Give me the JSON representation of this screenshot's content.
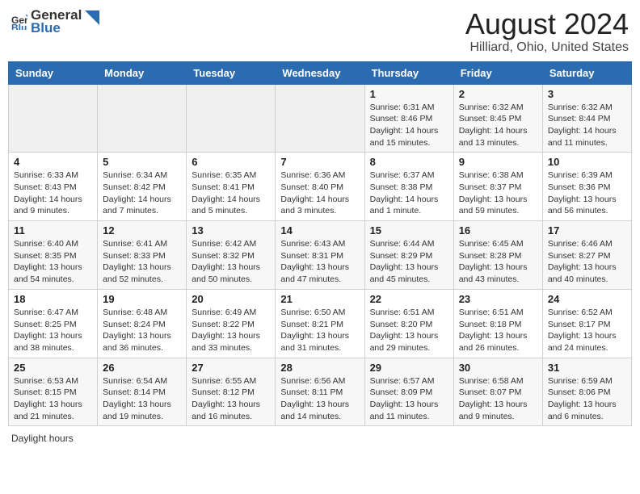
{
  "header": {
    "logo_general": "General",
    "logo_blue": "Blue",
    "month_title": "August 2024",
    "location": "Hilliard, Ohio, United States"
  },
  "days_of_week": [
    "Sunday",
    "Monday",
    "Tuesday",
    "Wednesday",
    "Thursday",
    "Friday",
    "Saturday"
  ],
  "weeks": [
    [
      {
        "day": "",
        "info": ""
      },
      {
        "day": "",
        "info": ""
      },
      {
        "day": "",
        "info": ""
      },
      {
        "day": "",
        "info": ""
      },
      {
        "day": "1",
        "sunrise": "Sunrise: 6:31 AM",
        "sunset": "Sunset: 8:46 PM",
        "daylight": "Daylight: 14 hours and 15 minutes."
      },
      {
        "day": "2",
        "sunrise": "Sunrise: 6:32 AM",
        "sunset": "Sunset: 8:45 PM",
        "daylight": "Daylight: 14 hours and 13 minutes."
      },
      {
        "day": "3",
        "sunrise": "Sunrise: 6:32 AM",
        "sunset": "Sunset: 8:44 PM",
        "daylight": "Daylight: 14 hours and 11 minutes."
      }
    ],
    [
      {
        "day": "4",
        "sunrise": "Sunrise: 6:33 AM",
        "sunset": "Sunset: 8:43 PM",
        "daylight": "Daylight: 14 hours and 9 minutes."
      },
      {
        "day": "5",
        "sunrise": "Sunrise: 6:34 AM",
        "sunset": "Sunset: 8:42 PM",
        "daylight": "Daylight: 14 hours and 7 minutes."
      },
      {
        "day": "6",
        "sunrise": "Sunrise: 6:35 AM",
        "sunset": "Sunset: 8:41 PM",
        "daylight": "Daylight: 14 hours and 5 minutes."
      },
      {
        "day": "7",
        "sunrise": "Sunrise: 6:36 AM",
        "sunset": "Sunset: 8:40 PM",
        "daylight": "Daylight: 14 hours and 3 minutes."
      },
      {
        "day": "8",
        "sunrise": "Sunrise: 6:37 AM",
        "sunset": "Sunset: 8:38 PM",
        "daylight": "Daylight: 14 hours and 1 minute."
      },
      {
        "day": "9",
        "sunrise": "Sunrise: 6:38 AM",
        "sunset": "Sunset: 8:37 PM",
        "daylight": "Daylight: 13 hours and 59 minutes."
      },
      {
        "day": "10",
        "sunrise": "Sunrise: 6:39 AM",
        "sunset": "Sunset: 8:36 PM",
        "daylight": "Daylight: 13 hours and 56 minutes."
      }
    ],
    [
      {
        "day": "11",
        "sunrise": "Sunrise: 6:40 AM",
        "sunset": "Sunset: 8:35 PM",
        "daylight": "Daylight: 13 hours and 54 minutes."
      },
      {
        "day": "12",
        "sunrise": "Sunrise: 6:41 AM",
        "sunset": "Sunset: 8:33 PM",
        "daylight": "Daylight: 13 hours and 52 minutes."
      },
      {
        "day": "13",
        "sunrise": "Sunrise: 6:42 AM",
        "sunset": "Sunset: 8:32 PM",
        "daylight": "Daylight: 13 hours and 50 minutes."
      },
      {
        "day": "14",
        "sunrise": "Sunrise: 6:43 AM",
        "sunset": "Sunset: 8:31 PM",
        "daylight": "Daylight: 13 hours and 47 minutes."
      },
      {
        "day": "15",
        "sunrise": "Sunrise: 6:44 AM",
        "sunset": "Sunset: 8:29 PM",
        "daylight": "Daylight: 13 hours and 45 minutes."
      },
      {
        "day": "16",
        "sunrise": "Sunrise: 6:45 AM",
        "sunset": "Sunset: 8:28 PM",
        "daylight": "Daylight: 13 hours and 43 minutes."
      },
      {
        "day": "17",
        "sunrise": "Sunrise: 6:46 AM",
        "sunset": "Sunset: 8:27 PM",
        "daylight": "Daylight: 13 hours and 40 minutes."
      }
    ],
    [
      {
        "day": "18",
        "sunrise": "Sunrise: 6:47 AM",
        "sunset": "Sunset: 8:25 PM",
        "daylight": "Daylight: 13 hours and 38 minutes."
      },
      {
        "day": "19",
        "sunrise": "Sunrise: 6:48 AM",
        "sunset": "Sunset: 8:24 PM",
        "daylight": "Daylight: 13 hours and 36 minutes."
      },
      {
        "day": "20",
        "sunrise": "Sunrise: 6:49 AM",
        "sunset": "Sunset: 8:22 PM",
        "daylight": "Daylight: 13 hours and 33 minutes."
      },
      {
        "day": "21",
        "sunrise": "Sunrise: 6:50 AM",
        "sunset": "Sunset: 8:21 PM",
        "daylight": "Daylight: 13 hours and 31 minutes."
      },
      {
        "day": "22",
        "sunrise": "Sunrise: 6:51 AM",
        "sunset": "Sunset: 8:20 PM",
        "daylight": "Daylight: 13 hours and 29 minutes."
      },
      {
        "day": "23",
        "sunrise": "Sunrise: 6:51 AM",
        "sunset": "Sunset: 8:18 PM",
        "daylight": "Daylight: 13 hours and 26 minutes."
      },
      {
        "day": "24",
        "sunrise": "Sunrise: 6:52 AM",
        "sunset": "Sunset: 8:17 PM",
        "daylight": "Daylight: 13 hours and 24 minutes."
      }
    ],
    [
      {
        "day": "25",
        "sunrise": "Sunrise: 6:53 AM",
        "sunset": "Sunset: 8:15 PM",
        "daylight": "Daylight: 13 hours and 21 minutes."
      },
      {
        "day": "26",
        "sunrise": "Sunrise: 6:54 AM",
        "sunset": "Sunset: 8:14 PM",
        "daylight": "Daylight: 13 hours and 19 minutes."
      },
      {
        "day": "27",
        "sunrise": "Sunrise: 6:55 AM",
        "sunset": "Sunset: 8:12 PM",
        "daylight": "Daylight: 13 hours and 16 minutes."
      },
      {
        "day": "28",
        "sunrise": "Sunrise: 6:56 AM",
        "sunset": "Sunset: 8:11 PM",
        "daylight": "Daylight: 13 hours and 14 minutes."
      },
      {
        "day": "29",
        "sunrise": "Sunrise: 6:57 AM",
        "sunset": "Sunset: 8:09 PM",
        "daylight": "Daylight: 13 hours and 11 minutes."
      },
      {
        "day": "30",
        "sunrise": "Sunrise: 6:58 AM",
        "sunset": "Sunset: 8:07 PM",
        "daylight": "Daylight: 13 hours and 9 minutes."
      },
      {
        "day": "31",
        "sunrise": "Sunrise: 6:59 AM",
        "sunset": "Sunset: 8:06 PM",
        "daylight": "Daylight: 13 hours and 6 minutes."
      }
    ]
  ],
  "footer": {
    "daylight_label": "Daylight hours"
  }
}
